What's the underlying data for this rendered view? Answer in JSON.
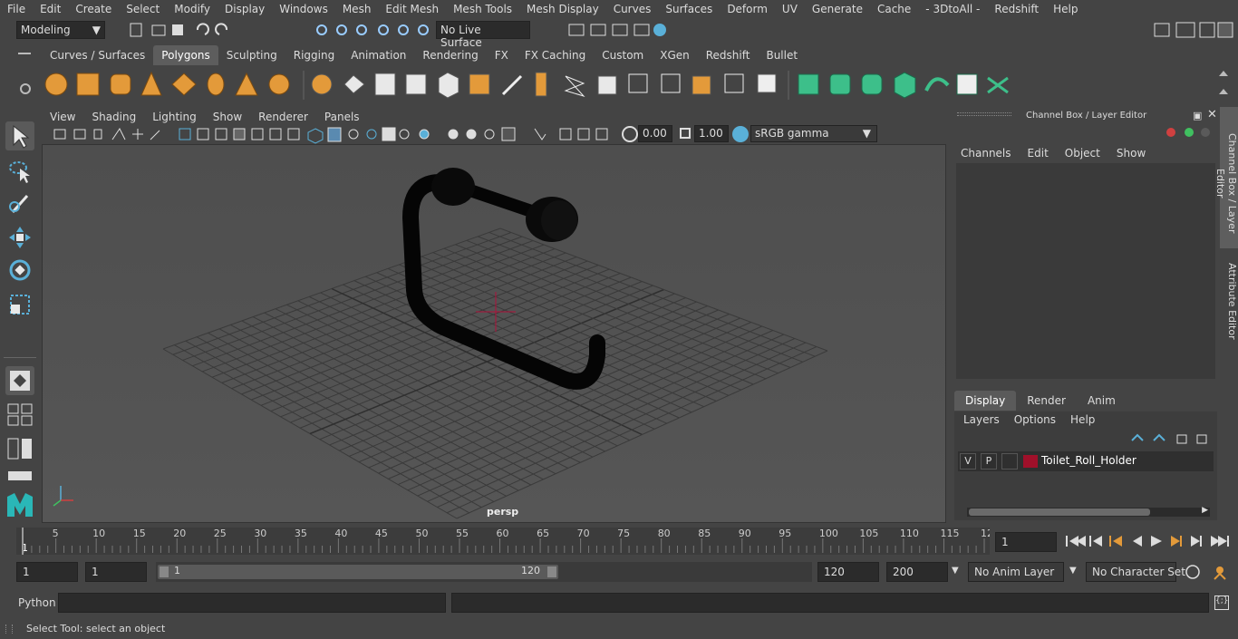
{
  "menubar": [
    "File",
    "Edit",
    "Create",
    "Select",
    "Modify",
    "Display",
    "Windows",
    "Mesh",
    "Edit Mesh",
    "Mesh Tools",
    "Mesh Display",
    "Curves",
    "Surfaces",
    "Deform",
    "UV",
    "Generate",
    "Cache",
    "- 3DtoAll -",
    "Redshift",
    "Help"
  ],
  "status": {
    "mode": "Modeling",
    "live_surface": "No Live Surface"
  },
  "shelf_tabs": [
    "Curves / Surfaces",
    "Polygons",
    "Sculpting",
    "Rigging",
    "Animation",
    "Rendering",
    "FX",
    "FX Caching",
    "Custom",
    "XGen",
    "Redshift",
    "Bullet"
  ],
  "viewport": {
    "menu": [
      "View",
      "Shading",
      "Lighting",
      "Show",
      "Renderer",
      "Panels"
    ],
    "exposure": "0.00",
    "gamma": "1.00",
    "colorspace": "sRGB gamma",
    "camera_label": "persp"
  },
  "channel_box": {
    "title": "Channel Box / Layer Editor",
    "menu": [
      "Channels",
      "Edit",
      "Object",
      "Show"
    ],
    "tabs": [
      "Display",
      "Render",
      "Anim"
    ],
    "layer_menu": [
      "Layers",
      "Options",
      "Help"
    ],
    "layer": {
      "v": "V",
      "p": "P",
      "name": "Toilet_Roll_Holder",
      "color": "#a0102a"
    }
  },
  "side_tabs": [
    "Channel Box / Layer Editor",
    "Attribute Editor"
  ],
  "timeline": {
    "ticks": [
      "5",
      "10",
      "15",
      "20",
      "25",
      "30",
      "35",
      "40",
      "45",
      "50",
      "55",
      "60",
      "65",
      "70",
      "75",
      "80",
      "85",
      "90",
      "95",
      "100",
      "105",
      "110",
      "115",
      "12"
    ],
    "start_marker": "1",
    "current_frame": "1"
  },
  "range": {
    "start": "1",
    "start2": "1",
    "slider_start": "1",
    "slider_end": "120",
    "end": "120",
    "end2": "200",
    "anim_layer": "No Anim Layer",
    "char_set": "No Character Set"
  },
  "cmdline": {
    "label": "Python"
  },
  "helpline": "Select Tool: select an object"
}
